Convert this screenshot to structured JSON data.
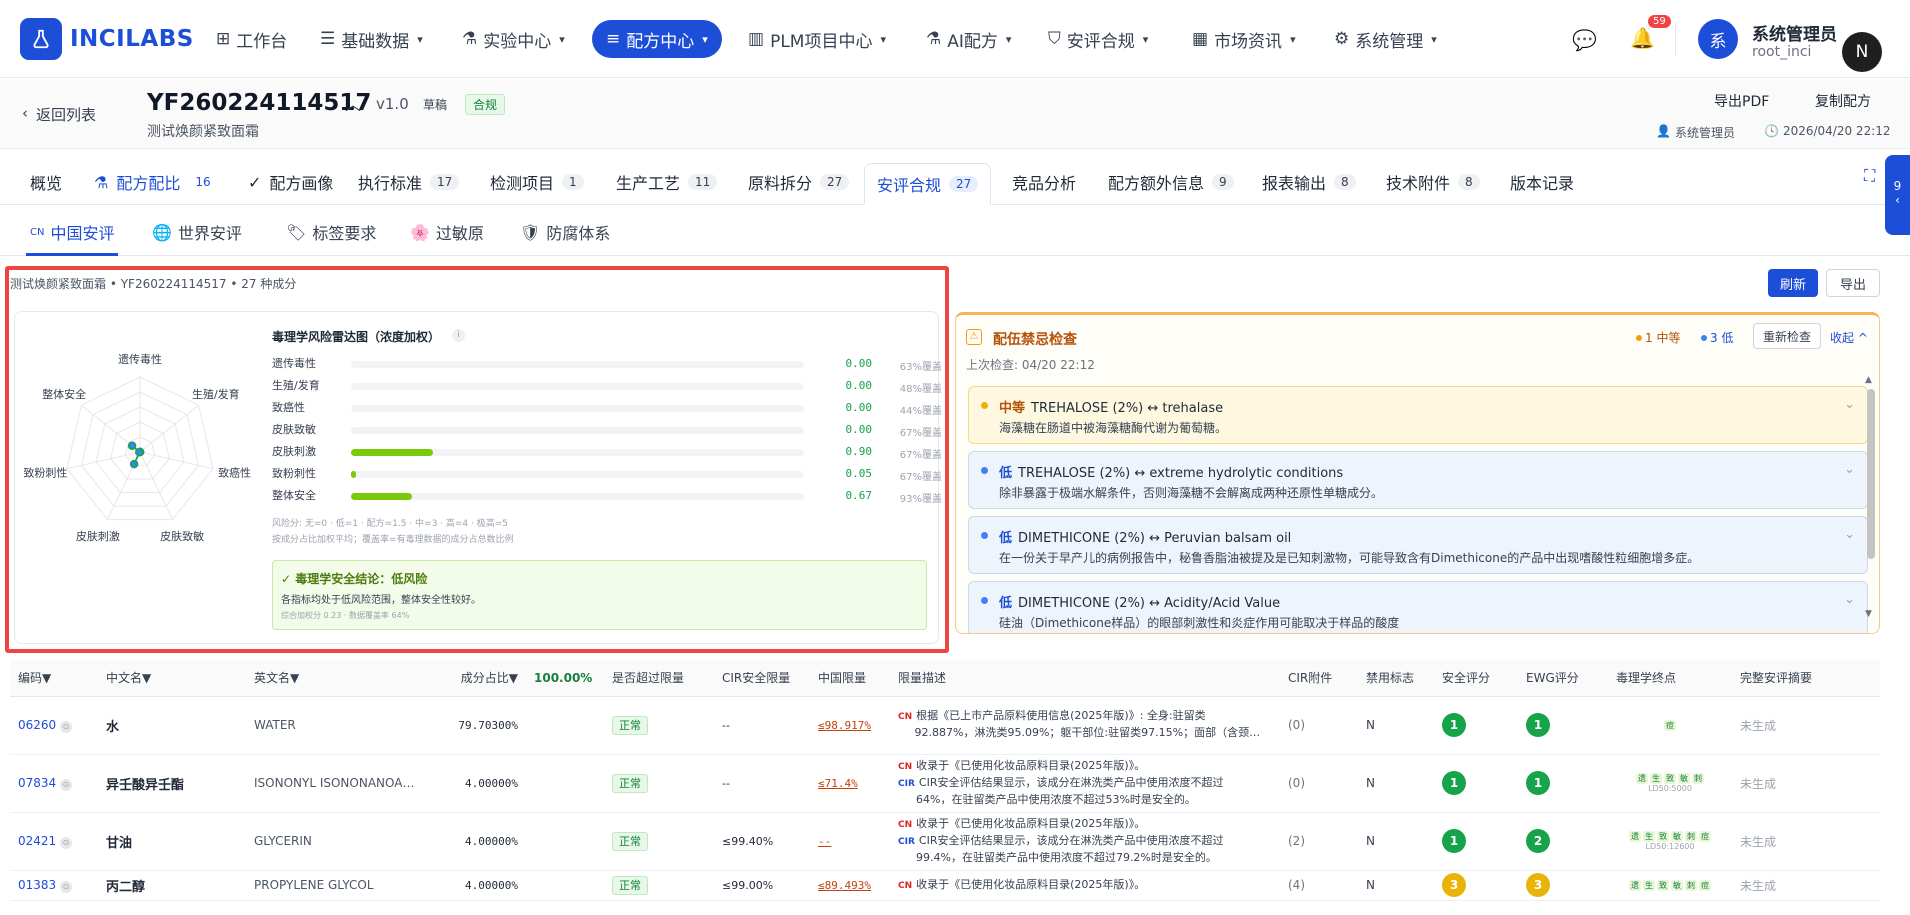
{
  "app": {
    "name": "INCILABS"
  },
  "nav": [
    {
      "label": "工作台"
    },
    {
      "label": "基础数据"
    },
    {
      "label": "实验中心"
    },
    {
      "label": "配方中心"
    },
    {
      "label": "PLM项目中心"
    },
    {
      "label": "AI配方"
    },
    {
      "label": "安评合规"
    },
    {
      "label": "市场资讯"
    },
    {
      "label": "系统管理"
    }
  ],
  "notifications": {
    "count": "59"
  },
  "user": {
    "avatar": "系",
    "name": "系统管理员",
    "account": "root_inci",
    "float_avatar": "N"
  },
  "header": {
    "back": "返回列表",
    "code": "YF260224114517",
    "version": "v1.0",
    "draft": "草稿",
    "status": "合规",
    "subtitle": "测试焕颜紧致面霜",
    "export_pdf": "导出PDF",
    "copy": "复制配方",
    "owner": "系统管理员",
    "time": "2026/04/20 22:12"
  },
  "tabs": [
    {
      "label": "概览",
      "count": ""
    },
    {
      "label": "配方配比",
      "count": "16"
    },
    {
      "label": "配方画像",
      "count": ""
    },
    {
      "label": "执行标准",
      "count": "17"
    },
    {
      "label": "检测项目",
      "count": "1"
    },
    {
      "label": "生产工艺",
      "count": "11"
    },
    {
      "label": "原料拆分",
      "count": "27"
    },
    {
      "label": "安评合规",
      "count": "27"
    },
    {
      "label": "竞品分析",
      "count": ""
    },
    {
      "label": "配方额外信息",
      "count": "9"
    },
    {
      "label": "报表输出",
      "count": "8"
    },
    {
      "label": "技术附件",
      "count": "8"
    },
    {
      "label": "版本记录",
      "count": ""
    }
  ],
  "side_drawer": {
    "count": "9"
  },
  "subtabs": [
    {
      "prefix": "CN",
      "label": "中国安评"
    },
    {
      "label": "世界安评"
    },
    {
      "label": "标签要求"
    },
    {
      "label": "过敏原"
    },
    {
      "label": "防腐体系"
    }
  ],
  "summary": {
    "text": "测试焕颜紧致面霜 • YF260224114517 • 27 种成分",
    "refresh": "刷新",
    "export": "导出"
  },
  "radar": {
    "title": "毒理学风险雷达图（浓度加权）",
    "axes": [
      "遗传毒性",
      "生殖/发育",
      "致癌性",
      "皮肤致敏",
      "皮肤刺激",
      "致粉刺性",
      "整体安全"
    ],
    "rows": [
      {
        "label": "遗传毒性",
        "value": "0.00",
        "frac": 0.0,
        "coverage": "63%覆盖"
      },
      {
        "label": "生殖/发育",
        "value": "0.00",
        "frac": 0.0,
        "coverage": "48%覆盖"
      },
      {
        "label": "致癌性",
        "value": "0.00",
        "frac": 0.0,
        "coverage": "44%覆盖"
      },
      {
        "label": "皮肤致敏",
        "value": "0.00",
        "frac": 0.0,
        "coverage": "67%覆盖"
      },
      {
        "label": "皮肤刺激",
        "value": "0.90",
        "frac": 0.18,
        "coverage": "67%覆盖"
      },
      {
        "label": "致粉刺性",
        "value": "0.05",
        "frac": 0.01,
        "coverage": "67%覆盖"
      },
      {
        "label": "整体安全",
        "value": "0.67",
        "frac": 0.134,
        "coverage": "93%覆盖"
      }
    ],
    "legend1": "风险分: 无=0 · 低=1 · 配方=1.5 · 中=3 · 高=4 · 极高=5",
    "legend2": "按成分占比加权平均；覆盖率=有毒理数据的成分占总数比例",
    "conclusion_title": "✓ 毒理学安全结论：低风险",
    "conclusion_text": "各指标均处于低风险范围，整体安全性较好。",
    "conclusion_meta": "综合加权分 0.23 · 数据覆盖率 64%"
  },
  "conflict": {
    "title": "配伍禁忌检查",
    "mid_count": "1 中等",
    "low_count": "3 低",
    "recheck": "重新检查",
    "collapse": "收起",
    "last_check": "上次检查: 04/20 22:12",
    "items": [
      {
        "level": "中等",
        "title": "TREHALOSE (2%) ↔ trehalase",
        "desc": "海藻糖在肠道中被海藻糖酶代谢为葡萄糖。"
      },
      {
        "level": "低",
        "title": "TREHALOSE (2%) ↔ extreme hydrolytic conditions",
        "desc": "除非暴露于极端水解条件，否则海藻糖不会解离成两种还原性单糖成分。"
      },
      {
        "level": "低",
        "title": "DIMETHICONE (2%) ↔ Peruvian balsam oil",
        "desc": "在一份关于早产儿的病例报告中，秘鲁香脂油被提及是已知刺激物，可能导致含有Dimethicone的产品中出现嗜酸性粒细胞增多症。"
      },
      {
        "level": "低",
        "title": "DIMETHICONE (2%) ↔ Acidity/Acid Value",
        "desc": "硅油（Dimethicone样品）的眼部刺激性和炎症作用可能取决于样品的酸度"
      }
    ]
  },
  "table": {
    "headers": [
      "编码▼",
      "中文名▼",
      "英文名▼",
      "成分占比▼",
      "100.00%",
      "是否超过限量",
      "CIR安全限量",
      "中国限量",
      "限量描述",
      "CIR附件",
      "禁用标志",
      "安全评分",
      "EWG评分",
      "毒理学终点",
      "完整安评摘要"
    ],
    "rows": [
      {
        "code": "06260",
        "cn": "水",
        "en": "WATER",
        "pct": "79.70300%",
        "over": "正常",
        "cir": "--",
        "china": "≤98.917%",
        "d1": "根据《已上市产品原料使用信息(2025年版)》: 全身:驻留类",
        "d2": "92.887%，淋洗类95.09%；躯干部位:驻留类97.15%；面部（含颈…",
        "d3": "",
        "att": "(0)",
        "ban": "N",
        "safe": "1",
        "ewg": "1",
        "tox": "痘",
        "toxmeta": "",
        "summary": "未生成"
      },
      {
        "code": "07834",
        "cn": "异壬酸异壬酯",
        "en": "ISONONYL ISONONANOA…",
        "pct": "4.00000%",
        "over": "正常",
        "cir": "--",
        "china": "≤71.4%",
        "d1": "收录于《已使用化妆品原料目录(2025年版)》。",
        "d2": "CIR安全评估结果显示，该成分在淋洗类产品中使用浓度不超过",
        "d3": "64%，在驻留类产品中使用浓度不超过53%时是安全的。",
        "att": "(0)",
        "ban": "N",
        "safe": "1",
        "ewg": "1",
        "tox": "遗 生 致 敏 刺",
        "toxmeta": "LD50:5000",
        "summary": "未生成"
      },
      {
        "code": "02421",
        "cn": "甘油",
        "en": "GLYCERIN",
        "pct": "4.00000%",
        "over": "正常",
        "cir": "≤99.40%",
        "china": "--",
        "d1": "收录于《已使用化妆品原料目录(2025年版)》。",
        "d2": "CIR安全评估结果显示，该成分在淋洗类产品中使用浓度不超过",
        "d3": "99.4%，在驻留类产品中使用浓度不超过79.2%时是安全的。",
        "att": "(2)",
        "ban": "N",
        "safe": "1",
        "ewg": "2",
        "tox": "遗 生 致 敏 刺 痘",
        "toxmeta": "LD50:12600",
        "summary": "未生成"
      },
      {
        "code": "01383",
        "cn": "丙二醇",
        "en": "PROPYLENE GLYCOL",
        "pct": "4.00000%",
        "over": "正常",
        "cir": "≤99.00%",
        "china": "≤89.493%",
        "d1": "收录于《已使用化妆品原料目录(2025年版)》。",
        "d2": "",
        "d3": "",
        "att": "(4)",
        "ban": "N",
        "safe": "3",
        "ewg": "3",
        "tox": "遗 生 致 敏 刺 痘",
        "toxmeta": "",
        "summary": "未生成"
      }
    ]
  }
}
